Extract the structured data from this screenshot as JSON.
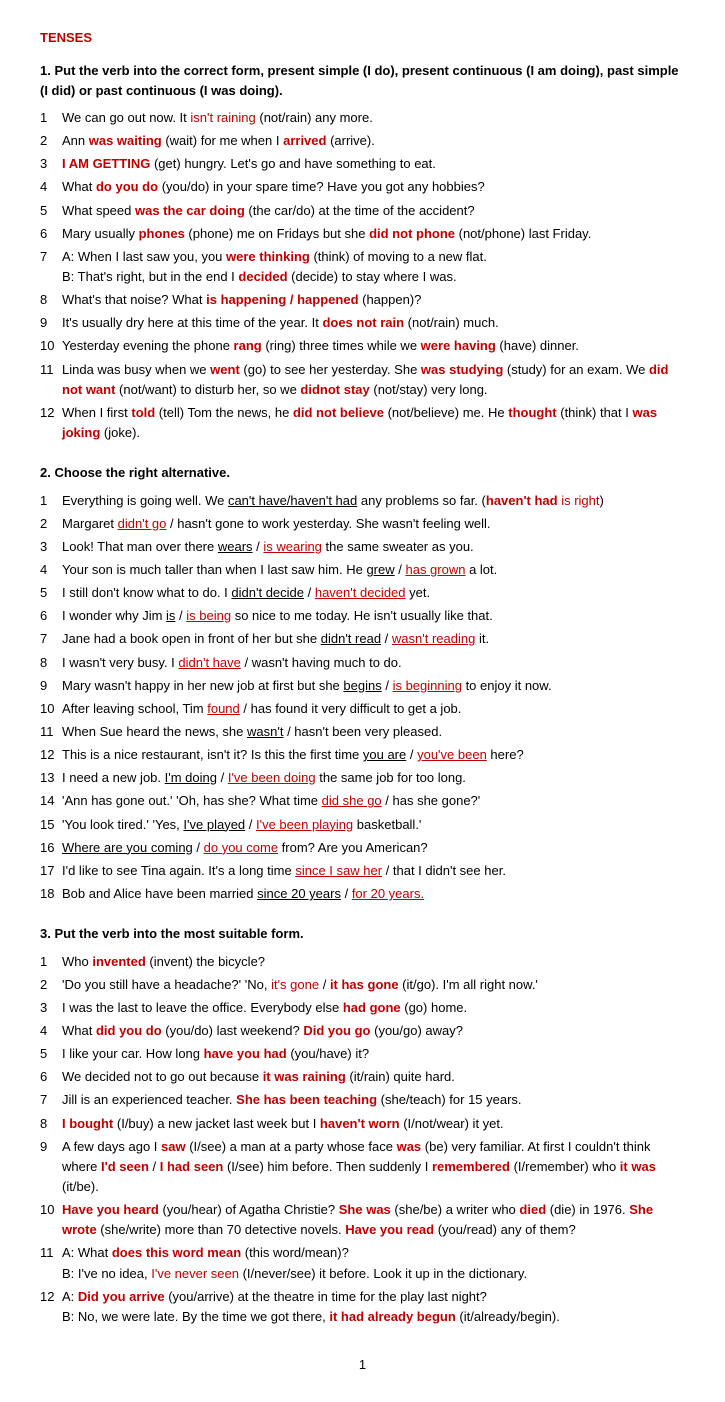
{
  "title": "TENSES",
  "sections": [
    {
      "id": "section1",
      "title": "1. Put the verb into the correct form, present simple (I do), present continuous (I am doing), past simple (I did) or past continuous (I was doing).",
      "items": []
    },
    {
      "id": "section2",
      "title": "2. Choose the right alternative.",
      "items": []
    },
    {
      "id": "section3",
      "title": "3. Put the verb into the most suitable form.",
      "items": []
    }
  ],
  "page_number": "1"
}
